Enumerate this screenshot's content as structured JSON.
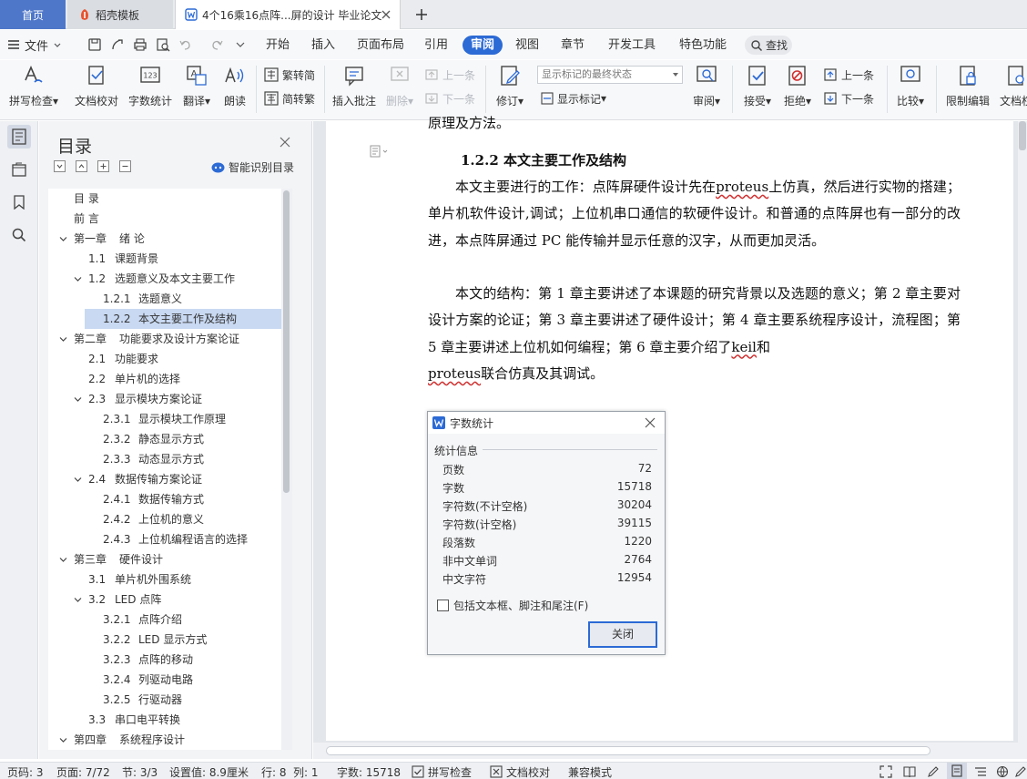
{
  "tabs": [
    {
      "label": "首页"
    },
    {
      "label": "稻壳模板"
    },
    {
      "label": "4个16乘16点阵...屏的设计 毕业论文"
    }
  ],
  "menu": {
    "file_label": "文件",
    "tabs": [
      "开始",
      "插入",
      "页面布局",
      "引用",
      "审阅",
      "视图",
      "章节",
      "开发工具",
      "特色功能"
    ],
    "search_label": "查找"
  },
  "ribbon": {
    "spell_check": "拼写检查",
    "doc_proof": "文档校对",
    "word_count": "字数统计",
    "translate": "翻译",
    "read_aloud": "朗读",
    "to_traditional": "繁转简",
    "to_simplified": "简转繁",
    "insert_comment": "插入批注",
    "delete": "删除",
    "prev_comment": "上一条",
    "next_comment": "下一条",
    "track_changes": "修订",
    "markup_select": "显示标记的最终状态",
    "show_markup": "显示标记",
    "review": "审阅",
    "accept": "接受",
    "reject": "拒绝",
    "prev_change": "上一条",
    "next_change": "下一条",
    "compare": "比较",
    "restrict_edit": "限制编辑",
    "doc_rights": "文档权"
  },
  "toc": {
    "title": "目录",
    "smart_label": "智能识别目录",
    "items": [
      {
        "num": "目 录",
        "text": ""
      },
      {
        "num": "前 言",
        "text": ""
      },
      {
        "num": "第一章",
        "text": "绪 论"
      },
      {
        "num": "1.1",
        "text": "课题背景"
      },
      {
        "num": "1.2",
        "text": "选题意义及本文主要工作"
      },
      {
        "num": "1.2.1",
        "text": "选题意义"
      },
      {
        "num": "1.2.2",
        "text": "本文主要工作及结构"
      },
      {
        "num": "第二章",
        "text": "功能要求及设计方案论证"
      },
      {
        "num": "2.1",
        "text": "功能要求"
      },
      {
        "num": "2.2",
        "text": "单片机的选择"
      },
      {
        "num": "2.3",
        "text": "显示模块方案论证"
      },
      {
        "num": "2.3.1",
        "text": "显示模块工作原理"
      },
      {
        "num": "2.3.2",
        "text": "静态显示方式"
      },
      {
        "num": "2.3.3",
        "text": "动态显示方式"
      },
      {
        "num": "2.4",
        "text": "数据传输方案论证"
      },
      {
        "num": "2.4.1",
        "text": "数据传输方式"
      },
      {
        "num": "2.4.2",
        "text": "上位机的意义"
      },
      {
        "num": "2.4.3",
        "text": "上位机编程语言的选择"
      },
      {
        "num": "第三章",
        "text": "硬件设计"
      },
      {
        "num": "3.1",
        "text": "单片机外围系统"
      },
      {
        "num": "3.2",
        "text": "LED 点阵"
      },
      {
        "num": "3.2.1",
        "text": "点阵介绍"
      },
      {
        "num": "3.2.2",
        "text": "LED 显示方式"
      },
      {
        "num": "3.2.3",
        "text": "点阵的移动"
      },
      {
        "num": "3.2.4",
        "text": "列驱动电路"
      },
      {
        "num": "3.2.5",
        "text": "行驱动器"
      },
      {
        "num": "3.3",
        "text": "串口电平转换"
      },
      {
        "num": "第四章",
        "text": "系统程序设计"
      }
    ]
  },
  "document": {
    "prev_line": "原理及方法。",
    "section_heading": "1.2.2 本文主要工作及结构",
    "para1": {
      "a": "本文主要进行的工作：点阵屏硬件设计先在",
      "w1": "proteus",
      "b": "上仿真，然后进行实物的搭建；单片机软件设计,调试；上位机串口通信的软硬件设计。和普通的点阵屏也有一部分的改进，本点阵屏通过 PC 能传输并显示任意的汉字，从而更加灵活。"
    },
    "para2": {
      "a": "本文的结构：第 1 章主要讲述了本课题的研究背景以及选题的意义；第 2 章主要对设计方案的论证；第 3 章主要讲述了硬件设计；第 4 章主要系统程序设计，流程图；第 5 章主要讲述上位机如何编程；第 6 章主要介绍了",
      "w1": "keil",
      "b": "和",
      "w2": "proteus",
      "c": "联合仿真及其调试。"
    }
  },
  "dialog": {
    "title": "字数统计",
    "group_label": "统计信息",
    "stats": [
      {
        "label": "页数",
        "value": "72"
      },
      {
        "label": "字数",
        "value": "15718"
      },
      {
        "label": "字符数(不计空格)",
        "value": "30204"
      },
      {
        "label": "字符数(计空格)",
        "value": "39115"
      },
      {
        "label": "段落数",
        "value": "1220"
      },
      {
        "label": "非中文单词",
        "value": "2764"
      },
      {
        "label": "中文字符",
        "value": "12954"
      }
    ],
    "include_label": "包括文本框、脚注和尾注(F)",
    "close_label": "关闭"
  },
  "status": {
    "page_code": "页码: 3",
    "page": "页面: 7/72",
    "section": "节: 3/3",
    "position": "设置值: 8.9厘米",
    "row": "行: 8",
    "col": "列: 1",
    "word_count": "字数: 15718",
    "spell_check": "拼写检查",
    "doc_proof": "文档校对",
    "compat_mode": "兼容模式"
  },
  "colors": {
    "accent": "#2c6ad5",
    "home_tab": "#4f77c9",
    "toc_selected": "#c9d9f2",
    "spell_error": "#d03030"
  }
}
